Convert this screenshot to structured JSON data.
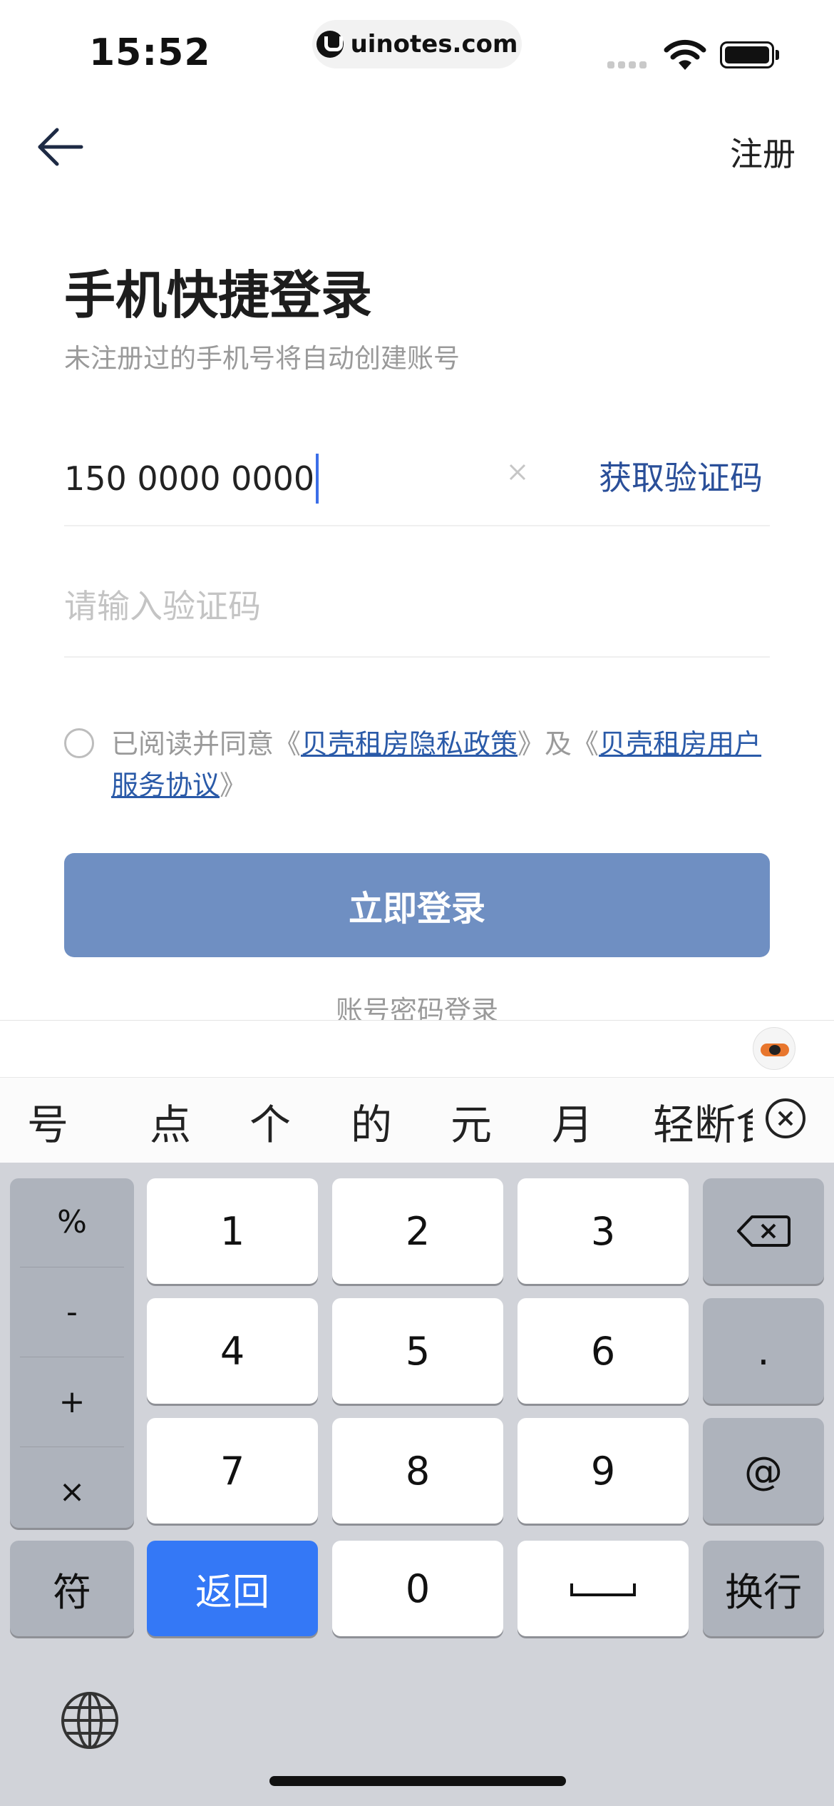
{
  "status_bar": {
    "time": "15:52",
    "url": "uinotes.com"
  },
  "nav": {
    "back_icon": "arrow-left-icon",
    "register_label": "注册"
  },
  "header": {
    "title": "手机快捷登录",
    "subtitle": "未注册过的手机号将自动创建账号"
  },
  "form": {
    "phone_value": "150 0000 0000",
    "get_code_label": "获取验证码",
    "code_placeholder": "请输入验证码"
  },
  "agreement": {
    "prefix": "已阅读并同意《",
    "privacy_link": "贝壳租房隐私政策",
    "middle": "》及《",
    "service_link": "贝壳租房用户服务协议",
    "suffix": "》",
    "checked": false
  },
  "login_button_label": "立即登录",
  "password_login_label": "账号密码登录",
  "keyboard": {
    "candidates": [
      "号",
      "点",
      "个",
      "的",
      "元",
      "月",
      "轻断食"
    ],
    "symbols": [
      "%",
      "-",
      "+",
      "×"
    ],
    "digits_row1": [
      "1",
      "2",
      "3"
    ],
    "digits_row2": [
      "4",
      "5",
      "6"
    ],
    "digits_row3": [
      "7",
      "8",
      "9"
    ],
    "dot_key": ".",
    "at_key": "@",
    "symbol_key": "符",
    "return_key": "返回",
    "zero_key": "0",
    "newline_key": "换行"
  }
}
